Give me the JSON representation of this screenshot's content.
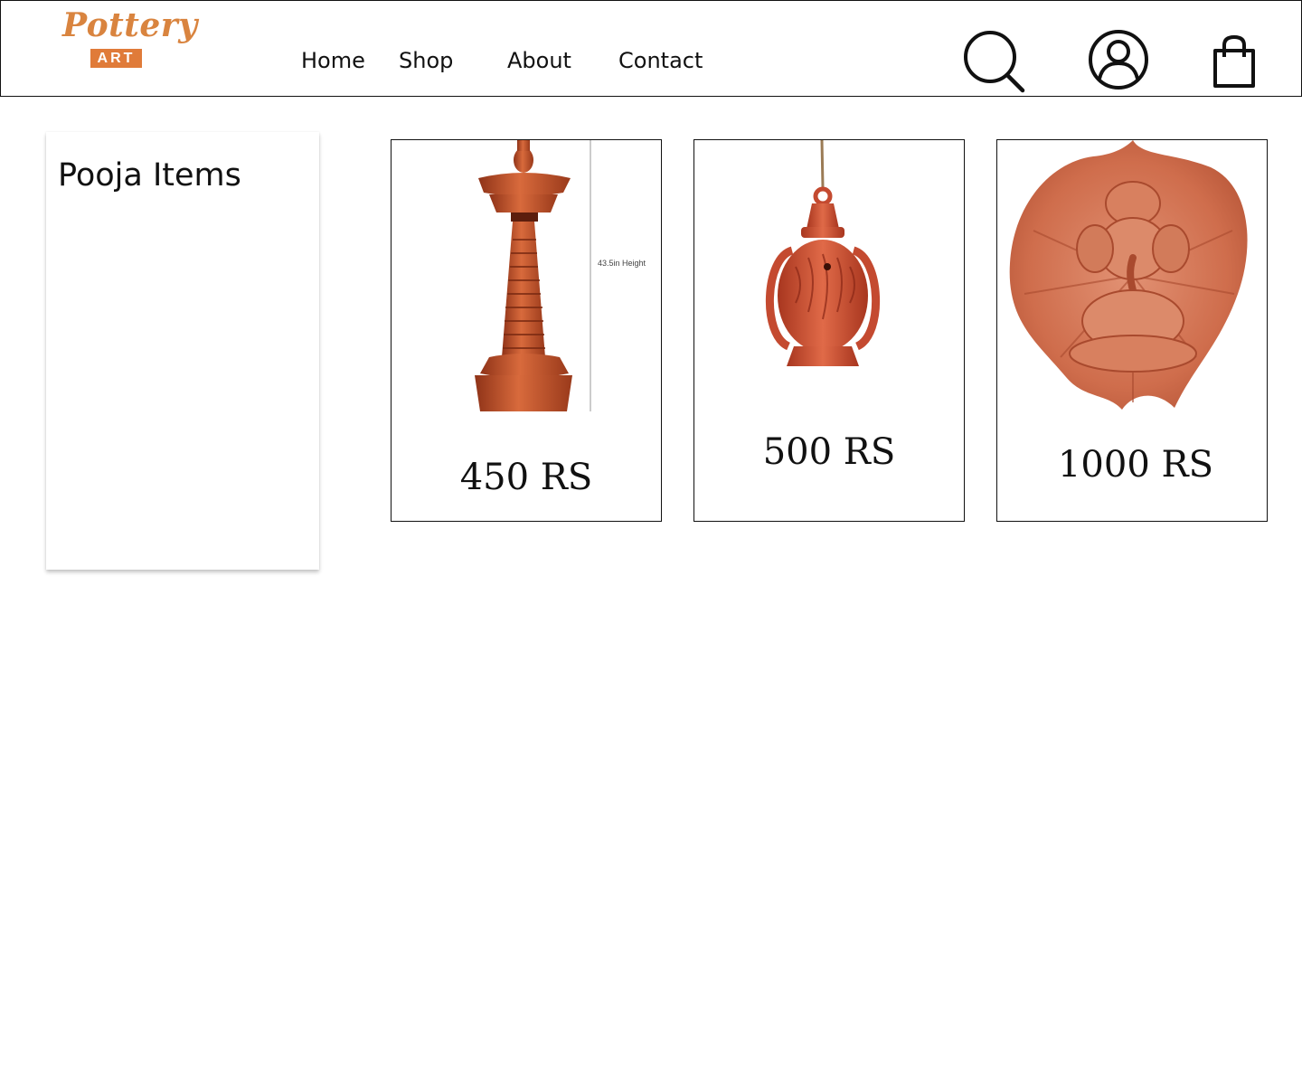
{
  "brand": {
    "logo_script": "Pottery",
    "logo_badge": "ART"
  },
  "nav": {
    "home": "Home",
    "shop": "Shop",
    "about": "About",
    "contact": "Contact"
  },
  "header_icons": [
    "search-icon",
    "user-account-icon",
    "shopping-bag-icon"
  ],
  "sidebar": {
    "title": "Pooja Items"
  },
  "products": [
    {
      "price": "450 RS",
      "image": "terracotta-oil-lamp-stand",
      "image_label": "43.5in Height"
    },
    {
      "price": "500 RS",
      "image": "terracotta-hanging-lantern"
    },
    {
      "price": "1000 RS",
      "image": "terracotta-ganesha-leaf-wall-plate"
    }
  ],
  "colors": {
    "terracotta": "#c8552f",
    "logo_orange": "#e07b39",
    "border": "#111111"
  }
}
